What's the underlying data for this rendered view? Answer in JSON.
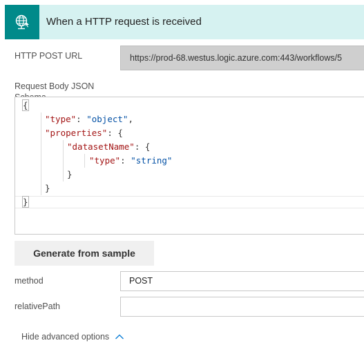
{
  "header": {
    "title": "When a HTTP request is received",
    "icon": "globe-request-icon",
    "accent": "#008a8a",
    "background": "#d6f2f1"
  },
  "url": {
    "label": "HTTP POST URL",
    "value": "https://prod-68.westus.logic.azure.com:443/workflows/5"
  },
  "schema": {
    "label": "Request Body JSON Schema",
    "lines": {
      "l1": {
        "brace": "{"
      },
      "l2": {
        "key": "\"type\"",
        "sep": ": ",
        "value": "\"object\"",
        "end": ","
      },
      "l3": {
        "key": "\"properties\"",
        "sep": ": ",
        "open": "{"
      },
      "l4": {
        "key": "\"datasetName\"",
        "sep": ": ",
        "open": "{"
      },
      "l5": {
        "key": "\"type\"",
        "sep": ": ",
        "value": "\"string\""
      },
      "l6": {
        "close": "}"
      },
      "l7": {
        "close": "}"
      },
      "l8": {
        "brace": "}"
      }
    }
  },
  "generate_button": {
    "label": "Generate from sample"
  },
  "method": {
    "label": "method",
    "value": "POST"
  },
  "relative_path": {
    "label": "relativePath",
    "value": ""
  },
  "advanced": {
    "label": "Hide advanced options",
    "icon": "chevron-up-icon"
  }
}
